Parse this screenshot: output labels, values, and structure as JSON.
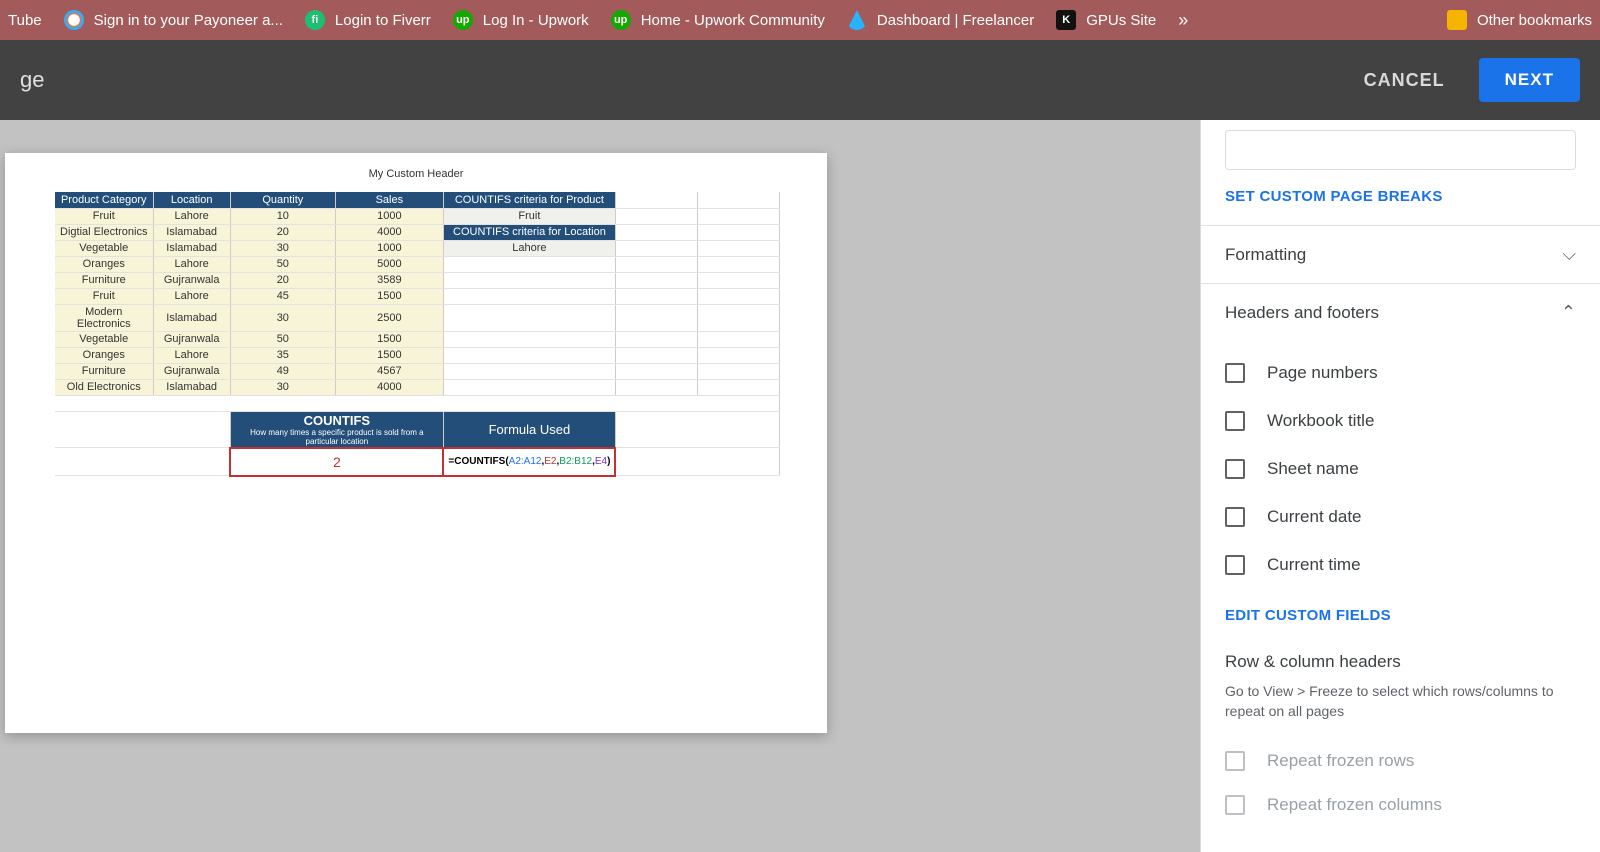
{
  "bookmarks": [
    {
      "label": "Tube",
      "icon_bg": "#cc0000",
      "icon_text": ""
    },
    {
      "label": "Sign in to your Payoneer a...",
      "icon_bg": "#ffffff",
      "icon_text": ""
    },
    {
      "label": "Login to Fiverr",
      "icon_bg": "#1dbf73",
      "icon_text": "fi"
    },
    {
      "label": "Log In - Upwork",
      "icon_bg": "#14a800",
      "icon_text": "up"
    },
    {
      "label": "Home - Upwork Community",
      "icon_bg": "#14a800",
      "icon_text": "up"
    },
    {
      "label": "Dashboard | Freelancer",
      "icon_bg": "#29b2fe",
      "icon_text": ""
    },
    {
      "label": "GPUs Site",
      "icon_bg": "#111111",
      "icon_text": "K"
    }
  ],
  "other_bookmarks": "Other bookmarks",
  "header": {
    "left": "ge",
    "cancel": "CANCEL",
    "next": "NEXT"
  },
  "page": {
    "custom_header": "My Custom Header",
    "col_headers": [
      "Product Category",
      "Location",
      "Quantity",
      "Sales",
      "COUNTIFS criteria for Product"
    ],
    "rows": [
      {
        "cat": "Fruit",
        "loc": "Lahore",
        "qty": "10",
        "sales": "1000",
        "crit": "Fruit",
        "crit_is_hdr": false
      },
      {
        "cat": "Digtial Electronics",
        "loc": "Islamabad",
        "qty": "20",
        "sales": "4000",
        "crit": "COUNTIFS criteria for Location",
        "crit_is_hdr": true
      },
      {
        "cat": "Vegetable",
        "loc": "Islamabad",
        "qty": "30",
        "sales": "1000",
        "crit": "Lahore",
        "crit_is_hdr": false
      },
      {
        "cat": "Oranges",
        "loc": "Lahore",
        "qty": "50",
        "sales": "5000",
        "crit": "",
        "crit_is_hdr": false
      },
      {
        "cat": "Furniture",
        "loc": "Gujranwala",
        "qty": "20",
        "sales": "3589",
        "crit": "",
        "crit_is_hdr": false
      },
      {
        "cat": "Fruit",
        "loc": "Lahore",
        "qty": "45",
        "sales": "1500",
        "crit": "",
        "crit_is_hdr": false
      },
      {
        "cat": "Modern Electronics",
        "loc": "Islamabad",
        "qty": "30",
        "sales": "2500",
        "crit": "",
        "crit_is_hdr": false
      },
      {
        "cat": "Vegetable",
        "loc": "Gujranwala",
        "qty": "50",
        "sales": "1500",
        "crit": "",
        "crit_is_hdr": false
      },
      {
        "cat": "Oranges",
        "loc": "Lahore",
        "qty": "35",
        "sales": "1500",
        "crit": "",
        "crit_is_hdr": false
      },
      {
        "cat": "Furniture",
        "loc": "Gujranwala",
        "qty": "49",
        "sales": "4567",
        "crit": "",
        "crit_is_hdr": false
      },
      {
        "cat": "Old Electronics",
        "loc": "Islamabad",
        "qty": "30",
        "sales": "4000",
        "crit": "",
        "crit_is_hdr": false
      }
    ],
    "countifs_title": "COUNTIFS",
    "countifs_sub": "How many times a specific product is sold from a particular location",
    "formula_used_label": "Formula Used",
    "result_value": "2",
    "formula": {
      "prefix": "=COUNTIFS(",
      "p1": "A2:A12",
      "c1": ",",
      "p2": "E2",
      "c2": ",",
      "p3": "B2:B12",
      "c3": ",",
      "p4": "E4",
      "suffix": ")"
    }
  },
  "sidebar": {
    "set_breaks": "SET CUSTOM PAGE BREAKS",
    "formatting": "Formatting",
    "headers_footers": "Headers and footers",
    "checks": [
      "Page numbers",
      "Workbook title",
      "Sheet name",
      "Current date",
      "Current time"
    ],
    "edit_custom": "EDIT CUSTOM FIELDS",
    "row_col_headers": "Row & column headers",
    "help": "Go to View > Freeze to select which rows/columns to repeat on all pages",
    "repeat_rows": "Repeat frozen rows",
    "repeat_cols": "Repeat frozen columns"
  }
}
